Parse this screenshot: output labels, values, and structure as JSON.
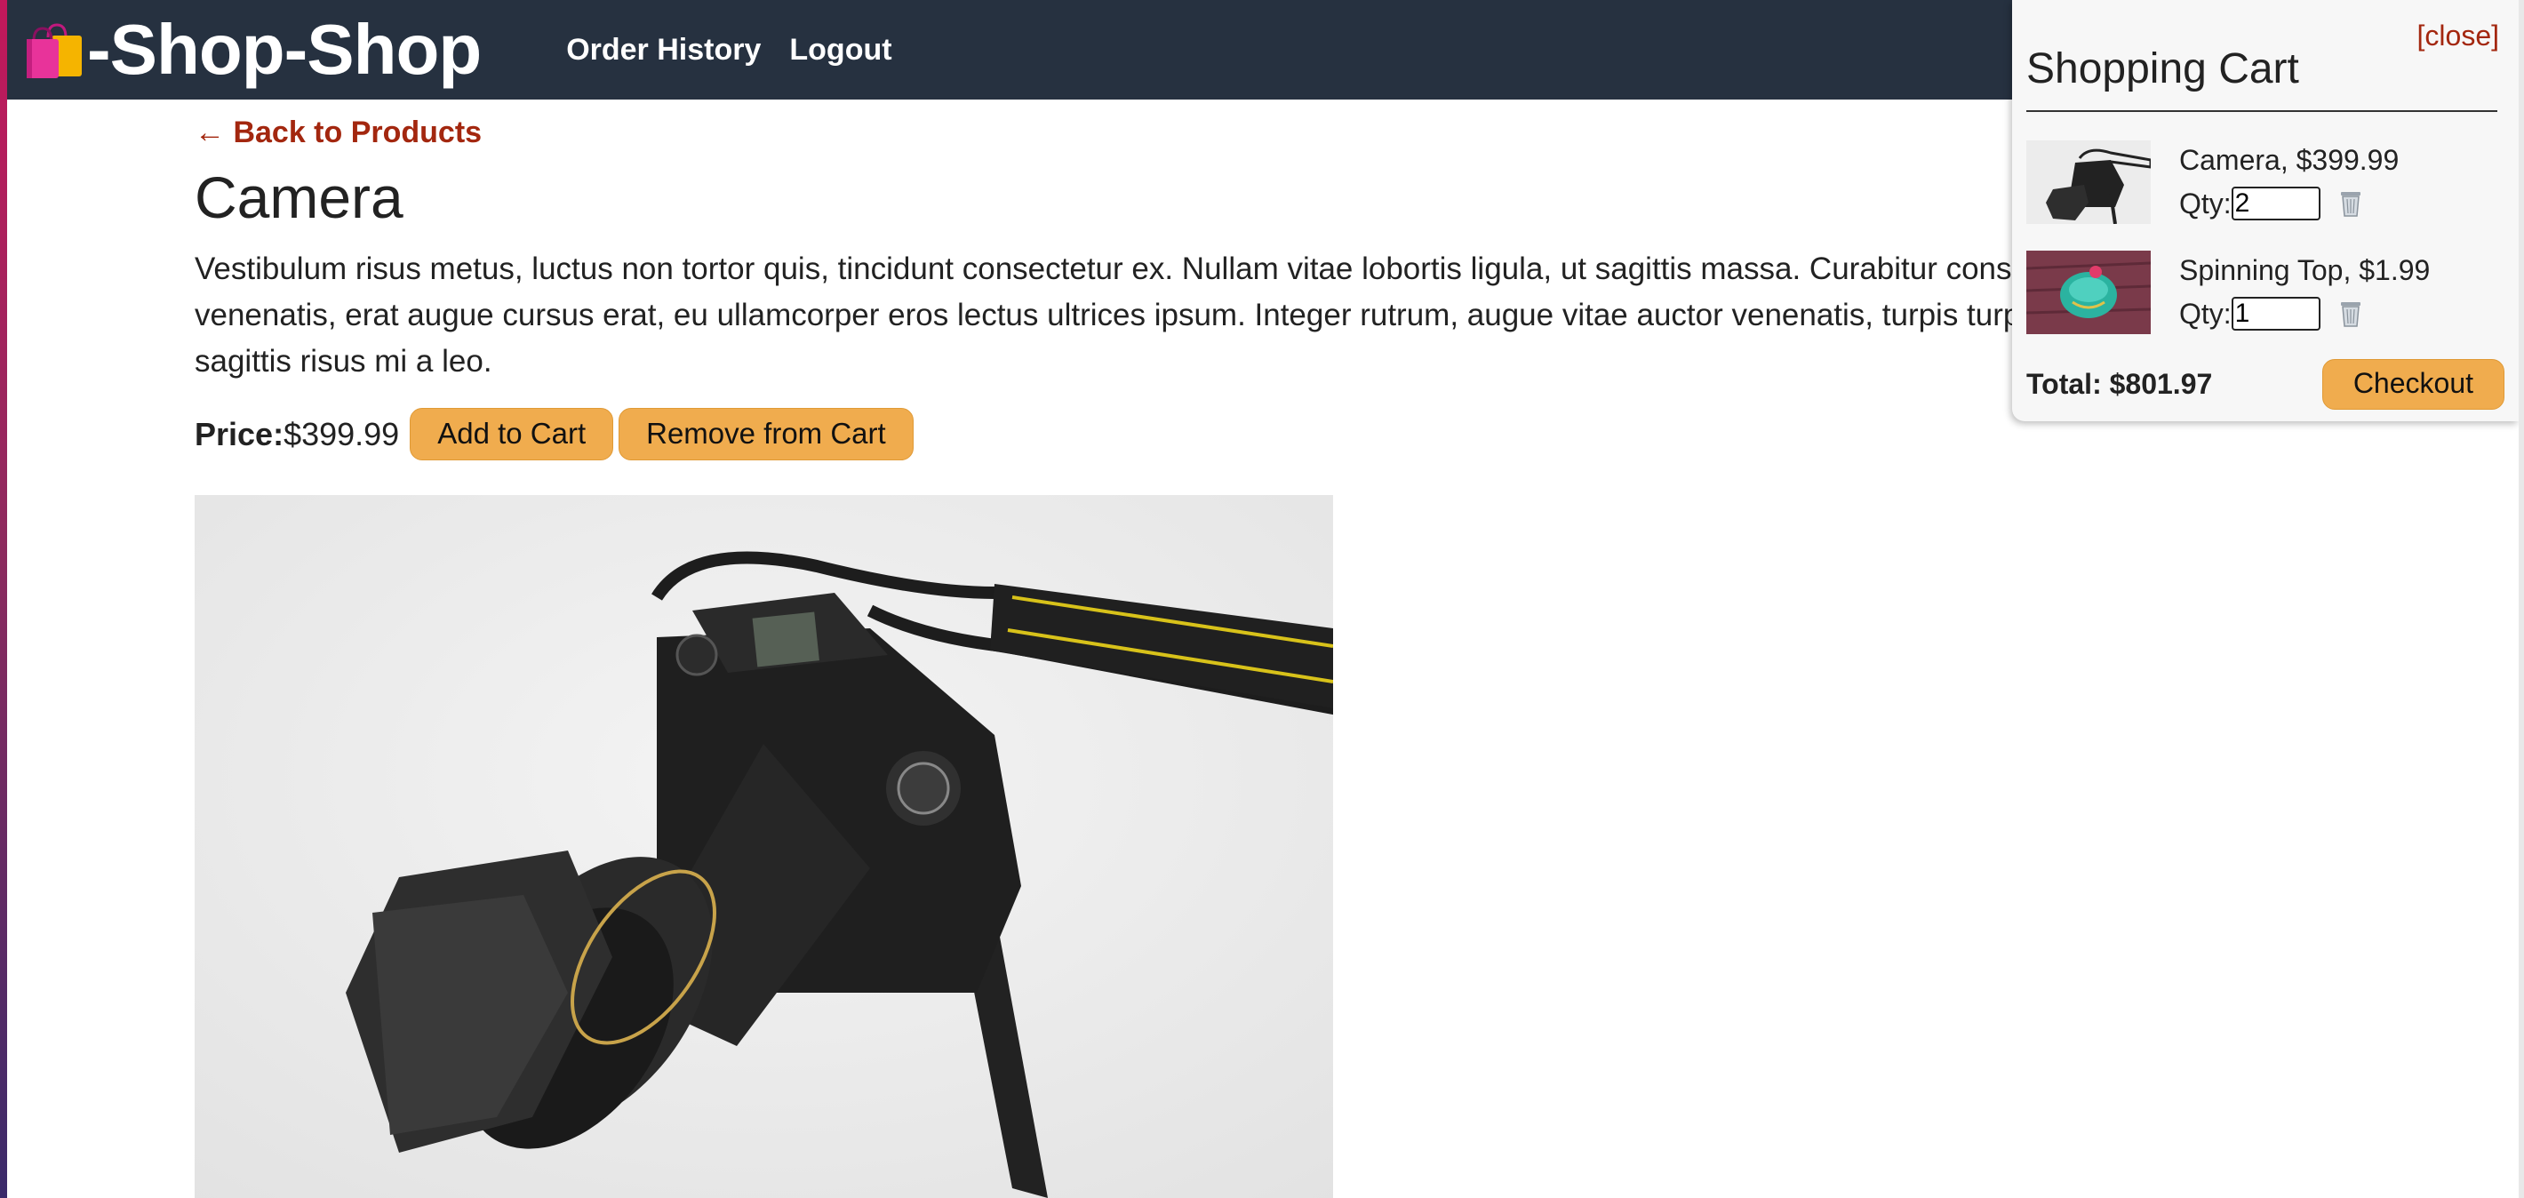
{
  "app": {
    "brand_text": "-Shop-Shop",
    "nav": [
      {
        "label": "Order History"
      },
      {
        "label": "Logout"
      }
    ]
  },
  "product": {
    "back_link": "← Back to Products",
    "title": "Camera",
    "description": "Vestibulum risus metus, luctus non tortor quis, tincidunt consectetur ex. Nullam vitae lobortis ligula, ut sagittis massa. Curabitur consectetur, tellus at pulvinar venenatis, erat augue cursus erat, eu ullamcorper eros lectus ultrices ipsum. Integer rutrum, augue vitae auctor venenatis, turpis turpis elementum orci, at sagittis risus mi a leo.",
    "price_label": "Price:",
    "price_value": "$399.99",
    "add_to_cart": "Add to Cart",
    "remove_from_cart": "Remove from Cart"
  },
  "cart": {
    "close_label": "[close]",
    "title": "Shopping Cart",
    "items": [
      {
        "name": "Camera, $399.99",
        "qty_label": "Qty:",
        "qty_value": "2"
      },
      {
        "name": "Spinning Top, $1.99",
        "qty_label": "Qty:",
        "qty_value": "1"
      }
    ],
    "total": "Total: $801.97",
    "checkout_label": "Checkout"
  },
  "colors": {
    "navbar": "#263140",
    "accent_link": "#a3270f",
    "button": "#f0ac4e"
  }
}
